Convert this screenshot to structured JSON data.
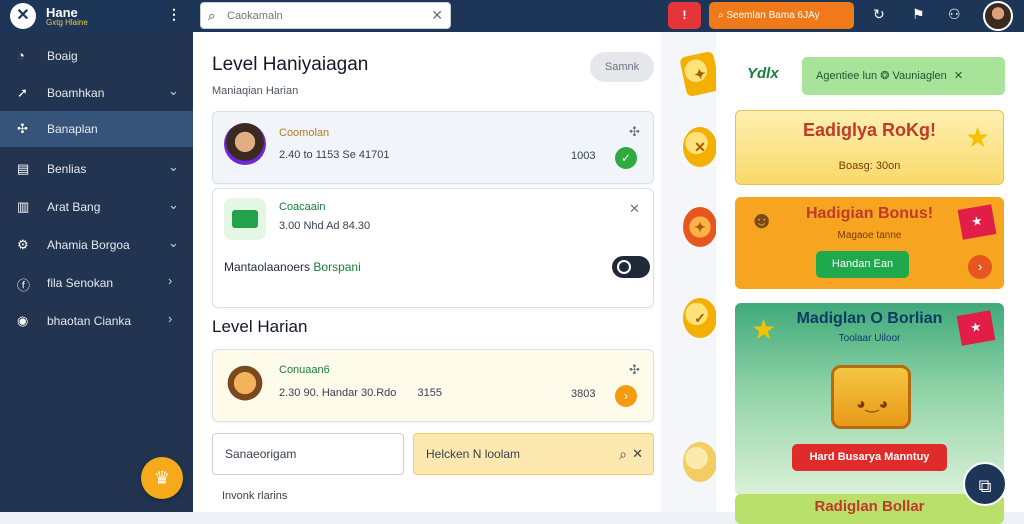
{
  "topbar": {
    "logo_text": "Hane",
    "logo_sub": "Gxtg Hlaine",
    "search_placeholder": "Caokamaln",
    "orange_label": "Seemlan Bama 6JAy"
  },
  "sidebar": {
    "items": [
      {
        "label": "Boaig",
        "icon": "gauge-icon"
      },
      {
        "label": "Boamhkan",
        "icon": "pin-icon"
      },
      {
        "label": "Banaplan",
        "icon": "gamepad-icon"
      },
      {
        "label": "Benlias",
        "icon": "card-icon"
      },
      {
        "label": "Arat Bang",
        "icon": "chart-icon"
      },
      {
        "label": "Ahamia Borgoa",
        "icon": "gear-icon"
      },
      {
        "label": "fila Senokan",
        "icon": "info-icon"
      },
      {
        "label": "bhaotan Cianka",
        "icon": "target-icon"
      }
    ]
  },
  "main": {
    "title": "Level Haniyaiagan",
    "subtitle": "Maniaqian Harian",
    "pill": "Samnk",
    "card1": {
      "name": "Coomolan",
      "meta": "2.40 to 1153 Se 41701",
      "num": "1003"
    },
    "card2": {
      "name": "Coacaain",
      "meta": "3.00 Nhd Ad 84.30",
      "toggle_label": "Mantaolaanoers",
      "toggle_label_green": "Borspani"
    },
    "section_title": "Level Harian",
    "card3": {
      "name": "Conuaan6",
      "meta": "2.30 90. Handar 30.Rdo",
      "meta2": "3155",
      "num": "3803"
    },
    "input_left": "Sanaeorigam",
    "input_right": "Helcken N loolam",
    "footer": "Invonk rlarins"
  },
  "right": {
    "logo": "Ydlx",
    "green_button": "Agentiee lun",
    "green_button_2": "Vauniaglen",
    "promo1": {
      "title": "Eadiglya RoKg!",
      "sub": "Boasg: 30on"
    },
    "promo2": {
      "title": "Hadigian Bonus!",
      "sub": "Magaoe tanne",
      "button": "Handan Ean"
    },
    "promo3": {
      "title": "Madiglan O Borlian",
      "sub": "Toolaar Uiloor",
      "button": "Hard Busarya Manntuy"
    },
    "promo4": {
      "title": "Radiglan Bollar"
    }
  },
  "colors": {
    "topbar": "#1d3557",
    "sidebar": "#22344f",
    "accent_orange": "#f07a1a",
    "accent_red": "#e5353b",
    "success_green": "#1fa84c"
  }
}
